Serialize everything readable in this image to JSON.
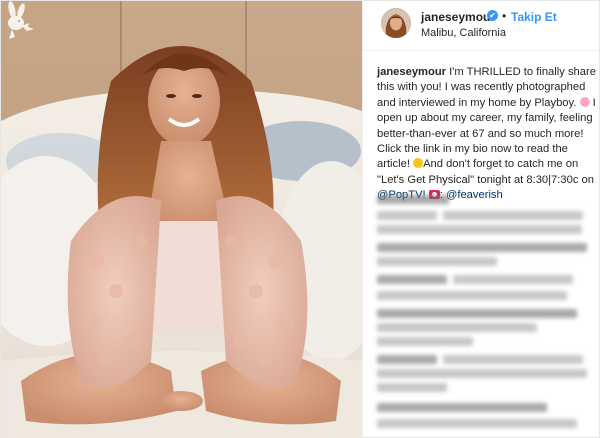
{
  "header": {
    "username": "janeseymour",
    "verified_mark": "✔",
    "separator": "•",
    "follow_label": "Takip Et",
    "location": "Malibu, California"
  },
  "caption": {
    "username": "janeseymour",
    "line_1": "I'm THRILLED to finally share this with you! I was recently photographed and interviewed in my home by Playboy.",
    "line_2": "I open up about my career, my family, feeling better-than-ever at 67 and so much more! Click the link in my bio now to read the article!",
    "line_3": "And don't forget to catch me on \"Let's Get Physical\" tonight at 8:30|7:30c on",
    "mention_1": "@PopTV!",
    "line_4": ":",
    "mention_2": "@feaverish"
  },
  "icons": {
    "verified": "verified-badge-icon",
    "flower_emoji": "cherry-blossom-emoji-icon",
    "smile_emoji": "smiling-face-emoji-icon",
    "camera_emoji": "camera-emoji-icon",
    "watermark": "playboy-bunny-logo"
  },
  "colors": {
    "link_blue": "#3897f0",
    "mention_blue": "#003569",
    "text": "#262626",
    "border": "#efefef"
  }
}
